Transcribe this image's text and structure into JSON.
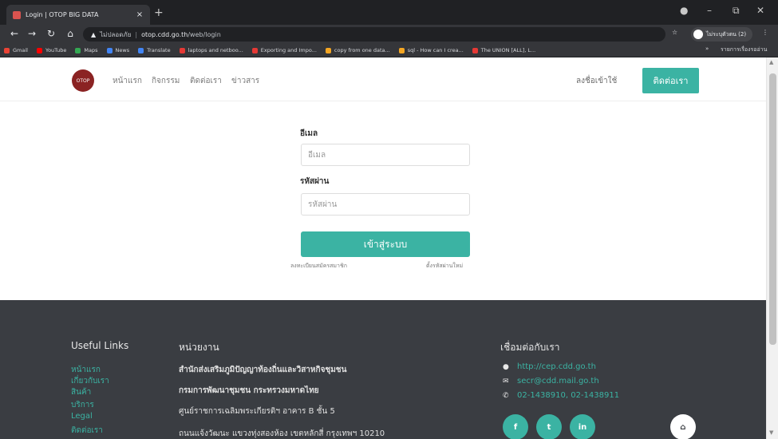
{
  "browser": {
    "tab_title": "Login | OTOP BIG DATA",
    "tab_close": "×",
    "new_tab": "+",
    "window_controls": [
      "–",
      "⧉",
      "✕"
    ],
    "address": {
      "security_label": "ไม่ปลอดภัย",
      "host": "otop.cdd.go.th",
      "path": "/web/login"
    },
    "profile_label": "ไม่ระบุตัวตน (2)",
    "bookmarks": [
      {
        "label": "Gmail",
        "color": "#ea4335"
      },
      {
        "label": "YouTube",
        "color": "#ff0000"
      },
      {
        "label": "Maps",
        "color": "#34a853"
      },
      {
        "label": "News",
        "color": "#4285f4"
      },
      {
        "label": "Translate",
        "color": "#4285f4"
      },
      {
        "label": "laptops and netboo...",
        "color": "#e53935"
      },
      {
        "label": "Exporting and Impo...",
        "color": "#e53935"
      },
      {
        "label": "copy from one data...",
        "color": "#f4a623"
      },
      {
        "label": "sql - How can I crea...",
        "color": "#f4a623"
      },
      {
        "label": "The UNION [ALL], L...",
        "color": "#e53935"
      }
    ],
    "reading_list": "รายการเรื่องรออ่าน"
  },
  "navbar": {
    "logo_text": "OTOP",
    "links": [
      "หน้าแรก",
      "กิจกรรม",
      "ติดต่อเรา",
      "ข่าวสาร"
    ],
    "register": "ลงชื่อเข้าใช้",
    "contact_button": "ติดต่อเรา"
  },
  "login_form": {
    "email_label": "อีเมล",
    "email_placeholder": "อีเมล",
    "password_label": "รหัสผ่าน",
    "password_placeholder": "รหัสผ่าน",
    "submit": "เข้าสู่ระบบ",
    "signup_link": "ลงทะเบียนสมัครสมาชิก",
    "reset_link": "ตั้งรหัสผ่านใหม่"
  },
  "footer": {
    "useful_links_title": "Useful Links",
    "useful_links": [
      "หน้าแรก",
      "เกี่ยวกับเรา",
      "สินค้า",
      "บริการ",
      "Legal",
      "ติดต่อเรา"
    ],
    "agency_title": "หน่วยงาน",
    "agency_lines": [
      "สำนักส่งเสริมภูมิปัญญาท้องถิ่นและวิสาหกิจชุมชน",
      "กรมการพัฒนาชุมชน กระทรวงมหาดไทย",
      "ศูนย์ราชการเฉลิมพระเกียรติฯ อาคาร B ชั้น 5",
      "ถนนแจ้งวัฒนะ แขวงทุ่งสองห้อง เขตหลักสี่ กรุงเทพฯ 10210"
    ],
    "connect_title": "เชื่อมต่อกับเรา",
    "contacts": [
      {
        "icon": "chat-icon",
        "glyph": "●",
        "text": "http://cep.cdd.go.th"
      },
      {
        "icon": "mail-icon",
        "glyph": "✉",
        "text": "secr@cdd.mail.go.th"
      },
      {
        "icon": "phone-icon",
        "glyph": "✆",
        "text": "02-1438910, 02-1438911"
      }
    ],
    "social": [
      "f",
      "t",
      "in"
    ]
  },
  "colors": {
    "accent": "#3bb3a3",
    "footer_bg": "#3a3d42"
  }
}
